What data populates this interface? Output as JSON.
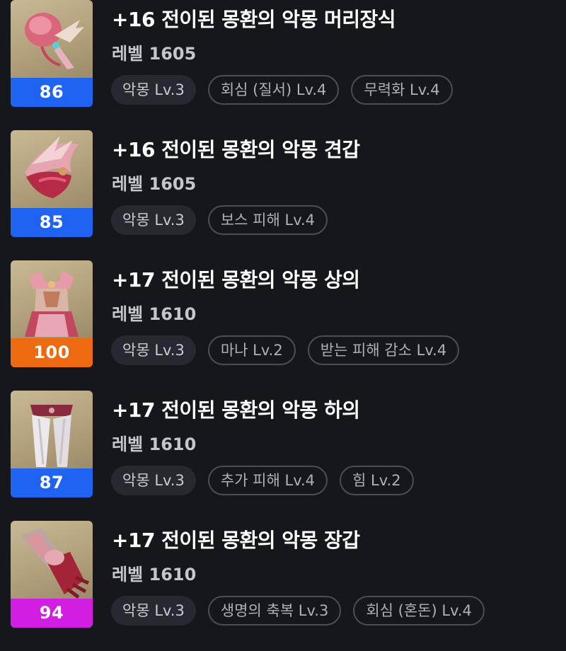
{
  "colors": {
    "background": "#15171d",
    "quality_blue": "#1f63f2",
    "quality_orange": "#ee6a10",
    "quality_magenta": "#d21ee2",
    "tag_fill": "#262930",
    "tag_border": "#4a4d55"
  },
  "items": [
    {
      "icon": "pink-headpiece-icon",
      "quality": "86",
      "quality_color": "#1f63f2",
      "title": "+16 전이된 몽환의 악몽 머리장식",
      "level": "레벨 1605",
      "tags": [
        "악몽 Lv.3",
        "회심 (질서) Lv.4",
        "무력화 Lv.4"
      ]
    },
    {
      "icon": "pink-shoulder-armor-icon",
      "quality": "85",
      "quality_color": "#1f63f2",
      "title": "+16 전이된 몽환의 악몽 견갑",
      "level": "레벨 1605",
      "tags": [
        "악몽 Lv.3",
        "보스 피해 Lv.4"
      ]
    },
    {
      "icon": "pink-chest-armor-icon",
      "quality": "100",
      "quality_color": "#ee6a10",
      "title": "+17 전이된 몽환의 악몽 상의",
      "level": "레벨 1610",
      "tags": [
        "악몽 Lv.3",
        "마나 Lv.2",
        "받는 피해 감소 Lv.4"
      ]
    },
    {
      "icon": "white-leggings-icon",
      "quality": "87",
      "quality_color": "#1f63f2",
      "title": "+17 전이된 몽환의 악몽 하의",
      "level": "레벨 1610",
      "tags": [
        "악몽 Lv.3",
        "추가 피해 Lv.4",
        "힘 Lv.2"
      ]
    },
    {
      "icon": "red-gauntlet-icon",
      "quality": "94",
      "quality_color": "#d21ee2",
      "title": "+17 전이된 몽환의 악몽 장갑",
      "level": "레벨 1610",
      "tags": [
        "악몽 Lv.3",
        "생명의 축복 Lv.3",
        "회심 (혼돈) Lv.4"
      ]
    }
  ]
}
